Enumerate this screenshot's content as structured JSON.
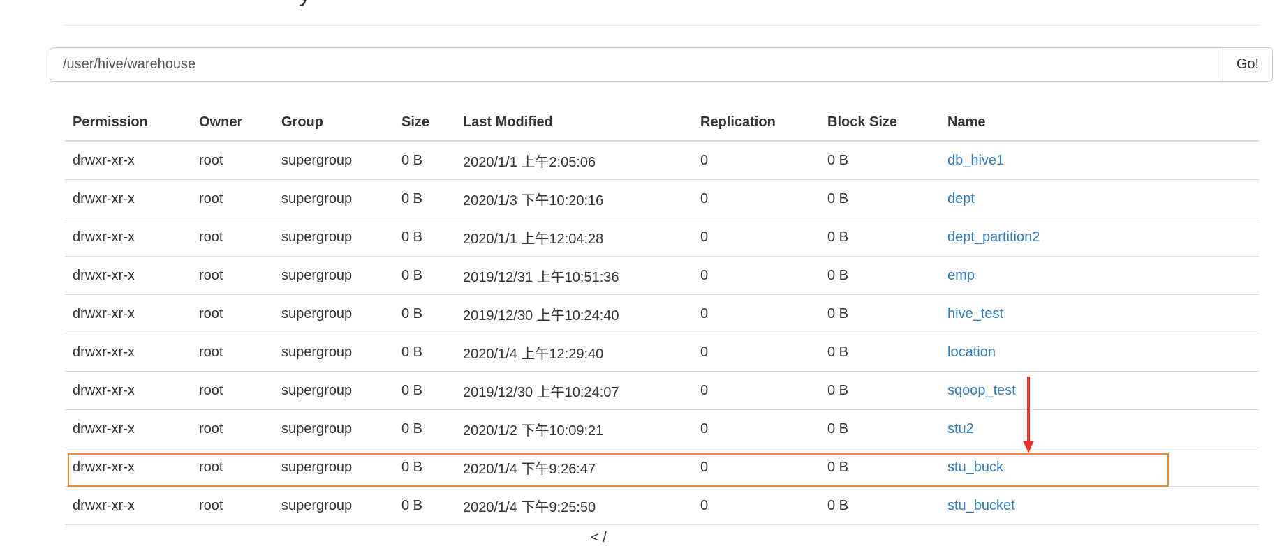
{
  "header": {
    "title_fragment": "y"
  },
  "path_bar": {
    "value": "/user/hive/warehouse",
    "go_label": "Go!"
  },
  "table": {
    "columns": [
      "Permission",
      "Owner",
      "Group",
      "Size",
      "Last Modified",
      "Replication",
      "Block Size",
      "Name"
    ],
    "rows": [
      [
        "drwxr-xr-x",
        "root",
        "supergroup",
        "0 B",
        "2020/1/1 上午2:05:06",
        "0",
        "0 B",
        "db_hive1"
      ],
      [
        "drwxr-xr-x",
        "root",
        "supergroup",
        "0 B",
        "2020/1/3 下午10:20:16",
        "0",
        "0 B",
        "dept"
      ],
      [
        "drwxr-xr-x",
        "root",
        "supergroup",
        "0 B",
        "2020/1/1 上午12:04:28",
        "0",
        "0 B",
        "dept_partition2"
      ],
      [
        "drwxr-xr-x",
        "root",
        "supergroup",
        "0 B",
        "2019/12/31 上午10:51:36",
        "0",
        "0 B",
        "emp"
      ],
      [
        "drwxr-xr-x",
        "root",
        "supergroup",
        "0 B",
        "2019/12/30 上午10:24:40",
        "0",
        "0 B",
        "hive_test"
      ],
      [
        "drwxr-xr-x",
        "root",
        "supergroup",
        "0 B",
        "2020/1/4 上午12:29:40",
        "0",
        "0 B",
        "location"
      ],
      [
        "drwxr-xr-x",
        "root",
        "supergroup",
        "0 B",
        "2019/12/30 上午10:24:07",
        "0",
        "0 B",
        "sqoop_test"
      ],
      [
        "drwxr-xr-x",
        "root",
        "supergroup",
        "0 B",
        "2020/1/2 下午10:09:21",
        "0",
        "0 B",
        "stu2"
      ],
      [
        "drwxr-xr-x",
        "root",
        "supergroup",
        "0 B",
        "2020/1/4 下午9:26:47",
        "0",
        "0 B",
        "stu_buck"
      ],
      [
        "drwxr-xr-x",
        "root",
        "supergroup",
        "0 B",
        "2020/1/4 下午9:25:50",
        "0",
        "0 B",
        "stu_bucket"
      ]
    ],
    "highlighted_row": 8
  },
  "footer": {
    "fragment": "< /"
  },
  "colors": {
    "link": "#337ab7",
    "highlight_border": "#f08a32",
    "arrow": "#e8322d",
    "rule": "#dddddd"
  },
  "icons": {
    "annotation_arrow": "down-arrow-icon"
  }
}
